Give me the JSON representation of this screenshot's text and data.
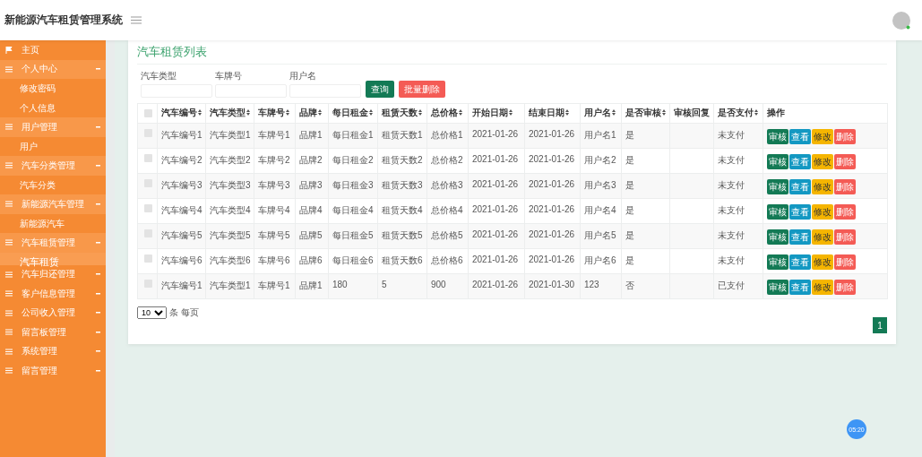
{
  "header": {
    "title": "新能源汽车租赁管理系统"
  },
  "sidebar": {
    "items": [
      {
        "kind": "home",
        "label": "主页",
        "expanded": false
      },
      {
        "kind": "group",
        "label": "个人中心",
        "expanded": true,
        "children": [
          {
            "label": "修改密码",
            "selected": false
          },
          {
            "label": "个人信息",
            "selected": false
          }
        ]
      },
      {
        "kind": "group",
        "label": "用户管理",
        "expanded": true,
        "children": [
          {
            "label": "用户",
            "selected": false
          }
        ]
      },
      {
        "kind": "group",
        "label": "汽车分类管理",
        "expanded": true,
        "children": [
          {
            "label": "汽车分类",
            "selected": false
          }
        ]
      },
      {
        "kind": "group",
        "label": "新能源汽车管理",
        "expanded": true,
        "children": [
          {
            "label": "新能源汽车",
            "selected": false
          }
        ]
      },
      {
        "kind": "group",
        "label": "汽车租赁管理",
        "expanded": true,
        "children": [
          {
            "label": "汽车租赁",
            "selected": true
          }
        ]
      },
      {
        "kind": "group",
        "label": "汽车归还管理",
        "expanded": false
      },
      {
        "kind": "group",
        "label": "客户信息管理",
        "expanded": false
      },
      {
        "kind": "group",
        "label": "公司收入管理",
        "expanded": false
      },
      {
        "kind": "group",
        "label": "留言板管理",
        "expanded": false
      },
      {
        "kind": "group",
        "label": "系统管理",
        "expanded": false
      },
      {
        "kind": "group",
        "label": "留言管理",
        "expanded": false
      }
    ]
  },
  "page": {
    "title": "汽车租赁列表",
    "filters": [
      {
        "label": "汽车类型"
      },
      {
        "label": "车牌号"
      },
      {
        "label": "用户名"
      }
    ],
    "buttons": [
      {
        "kind": "search",
        "label": "查询"
      },
      {
        "kind": "delete",
        "label": "批量删除"
      }
    ],
    "table": {
      "all_checked": false,
      "columns": [
        {
          "label": "汽车编号",
          "sortable": true
        },
        {
          "label": "汽车类型",
          "sortable": true
        },
        {
          "label": "车牌号",
          "sortable": true
        },
        {
          "label": "品牌",
          "sortable": true
        },
        {
          "label": "每日租金",
          "sortable": true
        },
        {
          "label": "租赁天数",
          "sortable": true
        },
        {
          "label": "总价格",
          "sortable": true
        },
        {
          "label": "开始日期",
          "sortable": true
        },
        {
          "label": "结束日期",
          "sortable": true
        },
        {
          "label": "用户名",
          "sortable": true
        },
        {
          "label": "是否审核",
          "sortable": true
        },
        {
          "label": "审核回复",
          "sortable": false
        },
        {
          "label": "是否支付",
          "sortable": true
        },
        {
          "label": "操作",
          "sortable": false
        }
      ],
      "rows": [
        {
          "checked": false,
          "cells": [
            "汽车编号1",
            "汽车类型1",
            "车牌号1",
            "品牌1",
            "每日租金1",
            "租赁天数1",
            "总价格1",
            "2021-01-26",
            "2021-01-26",
            "用户名1",
            "是",
            "",
            "未支付"
          ],
          "actions": [
            {
              "kind": "review",
              "label": "审核"
            },
            {
              "kind": "view",
              "label": "查看"
            },
            {
              "kind": "edit",
              "label": "修改"
            },
            {
              "kind": "delete",
              "label": "删除"
            }
          ]
        },
        {
          "checked": false,
          "cells": [
            "汽车编号2",
            "汽车类型2",
            "车牌号2",
            "品牌2",
            "每日租金2",
            "租赁天数2",
            "总价格2",
            "2021-01-26",
            "2021-01-26",
            "用户名2",
            "是",
            "",
            "未支付"
          ],
          "actions": [
            {
              "kind": "review",
              "label": "审核"
            },
            {
              "kind": "view",
              "label": "查看"
            },
            {
              "kind": "edit",
              "label": "修改"
            },
            {
              "kind": "delete",
              "label": "删除"
            }
          ]
        },
        {
          "checked": false,
          "cells": [
            "汽车编号3",
            "汽车类型3",
            "车牌号3",
            "品牌3",
            "每日租金3",
            "租赁天数3",
            "总价格3",
            "2021-01-26",
            "2021-01-26",
            "用户名3",
            "是",
            "",
            "未支付"
          ],
          "actions": [
            {
              "kind": "review",
              "label": "审核"
            },
            {
              "kind": "view",
              "label": "查看"
            },
            {
              "kind": "edit",
              "label": "修改"
            },
            {
              "kind": "delete",
              "label": "删除"
            }
          ]
        },
        {
          "checked": false,
          "cells": [
            "汽车编号4",
            "汽车类型4",
            "车牌号4",
            "品牌4",
            "每日租金4",
            "租赁天数4",
            "总价格4",
            "2021-01-26",
            "2021-01-26",
            "用户名4",
            "是",
            "",
            "未支付"
          ],
          "actions": [
            {
              "kind": "review",
              "label": "审核"
            },
            {
              "kind": "view",
              "label": "查看"
            },
            {
              "kind": "edit",
              "label": "修改"
            },
            {
              "kind": "delete",
              "label": "删除"
            }
          ]
        },
        {
          "checked": false,
          "cells": [
            "汽车编号5",
            "汽车类型5",
            "车牌号5",
            "品牌5",
            "每日租金5",
            "租赁天数5",
            "总价格5",
            "2021-01-26",
            "2021-01-26",
            "用户名5",
            "是",
            "",
            "未支付"
          ],
          "actions": [
            {
              "kind": "review",
              "label": "审核"
            },
            {
              "kind": "view",
              "label": "查看"
            },
            {
              "kind": "edit",
              "label": "修改"
            },
            {
              "kind": "delete",
              "label": "删除"
            }
          ]
        },
        {
          "checked": false,
          "cells": [
            "汽车编号6",
            "汽车类型6",
            "车牌号6",
            "品牌6",
            "每日租金6",
            "租赁天数6",
            "总价格6",
            "2021-01-26",
            "2021-01-26",
            "用户名6",
            "是",
            "",
            "未支付"
          ],
          "actions": [
            {
              "kind": "review",
              "label": "审核"
            },
            {
              "kind": "view",
              "label": "查看"
            },
            {
              "kind": "edit",
              "label": "修改"
            },
            {
              "kind": "delete",
              "label": "删除"
            }
          ]
        },
        {
          "checked": false,
          "cells": [
            "汽车编号1",
            "汽车类型1",
            "车牌号1",
            "品牌1",
            "180",
            "5",
            "900",
            "2021-01-26",
            "2021-01-30",
            "123",
            "否",
            "",
            "已支付"
          ],
          "actions": [
            {
              "kind": "review",
              "label": "审核"
            },
            {
              "kind": "view",
              "label": "查看"
            },
            {
              "kind": "edit",
              "label": "修改"
            },
            {
              "kind": "delete",
              "label": "删除"
            }
          ]
        }
      ]
    },
    "page_size": {
      "value": "10",
      "suffix": "条 每页"
    },
    "pages": [
      {
        "label": "1",
        "selected": true
      }
    ]
  },
  "timer_badge": "05:20"
}
